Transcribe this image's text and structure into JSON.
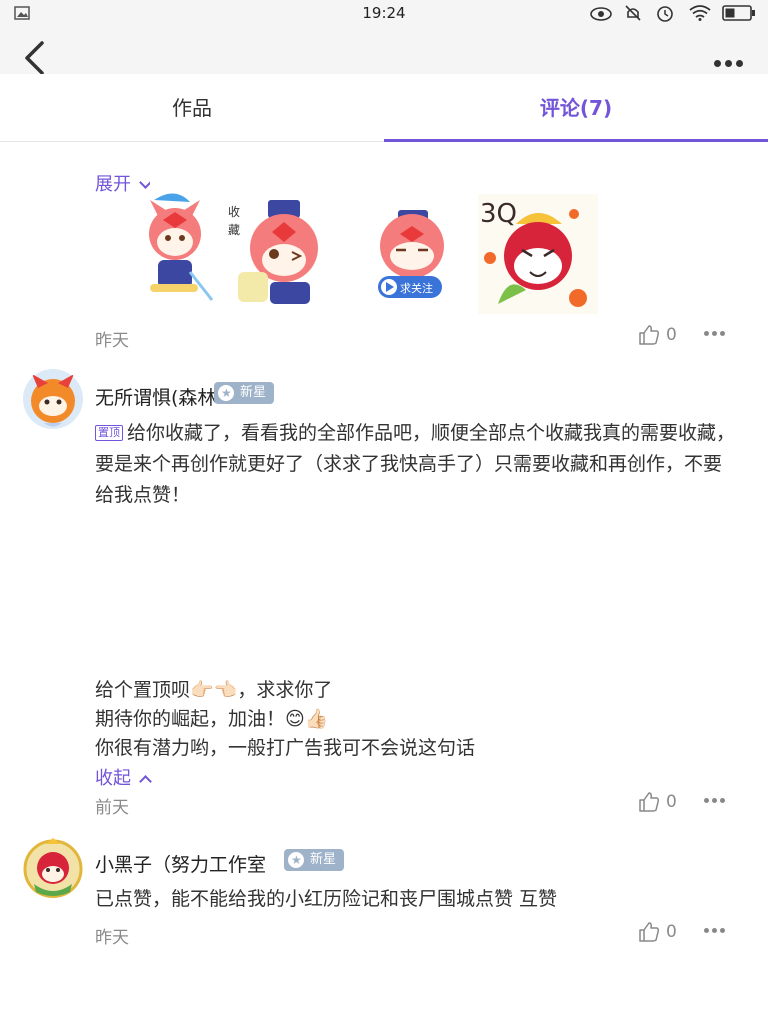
{
  "status": {
    "time": "19:24"
  },
  "tabs": [
    {
      "label": "作品",
      "active": false
    },
    {
      "label": "评论(7)",
      "active": true
    }
  ],
  "accent_color": "#7255d8",
  "comment0": {
    "expand_label": "展开",
    "stickers": [
      {
        "name": "cat-mascot-sticker",
        "caption": ""
      },
      {
        "name": "collect-sticker",
        "caption": "收藏"
      },
      {
        "name": "follow-sticker",
        "caption": "求关注"
      },
      {
        "name": "thanks-sticker",
        "caption": "3Q"
      }
    ],
    "time": "昨天",
    "likes": "0"
  },
  "comment1": {
    "username": "无所谓惧(森林",
    "badge": "新星",
    "pin_tag": "置顶",
    "text": "给你收藏了，看看我的全部作品吧，顺便全部点个收藏我真的需要收藏，要是来个再创作就更好了（求求了我快高手了）只需要收藏和再创作，不要给我点赞！",
    "extra_lines": [
      "给个置顶呗👉🏻👈🏻，求求你了",
      "期待你的崛起，加油！😊👍🏻",
      "你很有潜力哟，一般打广告我可不会说这句话"
    ],
    "collapse_label": "收起",
    "time": "前天",
    "likes": "0"
  },
  "comment2": {
    "username": "小黑子（努力工作室",
    "badge": "新星",
    "text": "已点赞，能不能给我的小红历险记和丧尸围城点赞 互赞",
    "time": "昨天",
    "likes": "0"
  }
}
